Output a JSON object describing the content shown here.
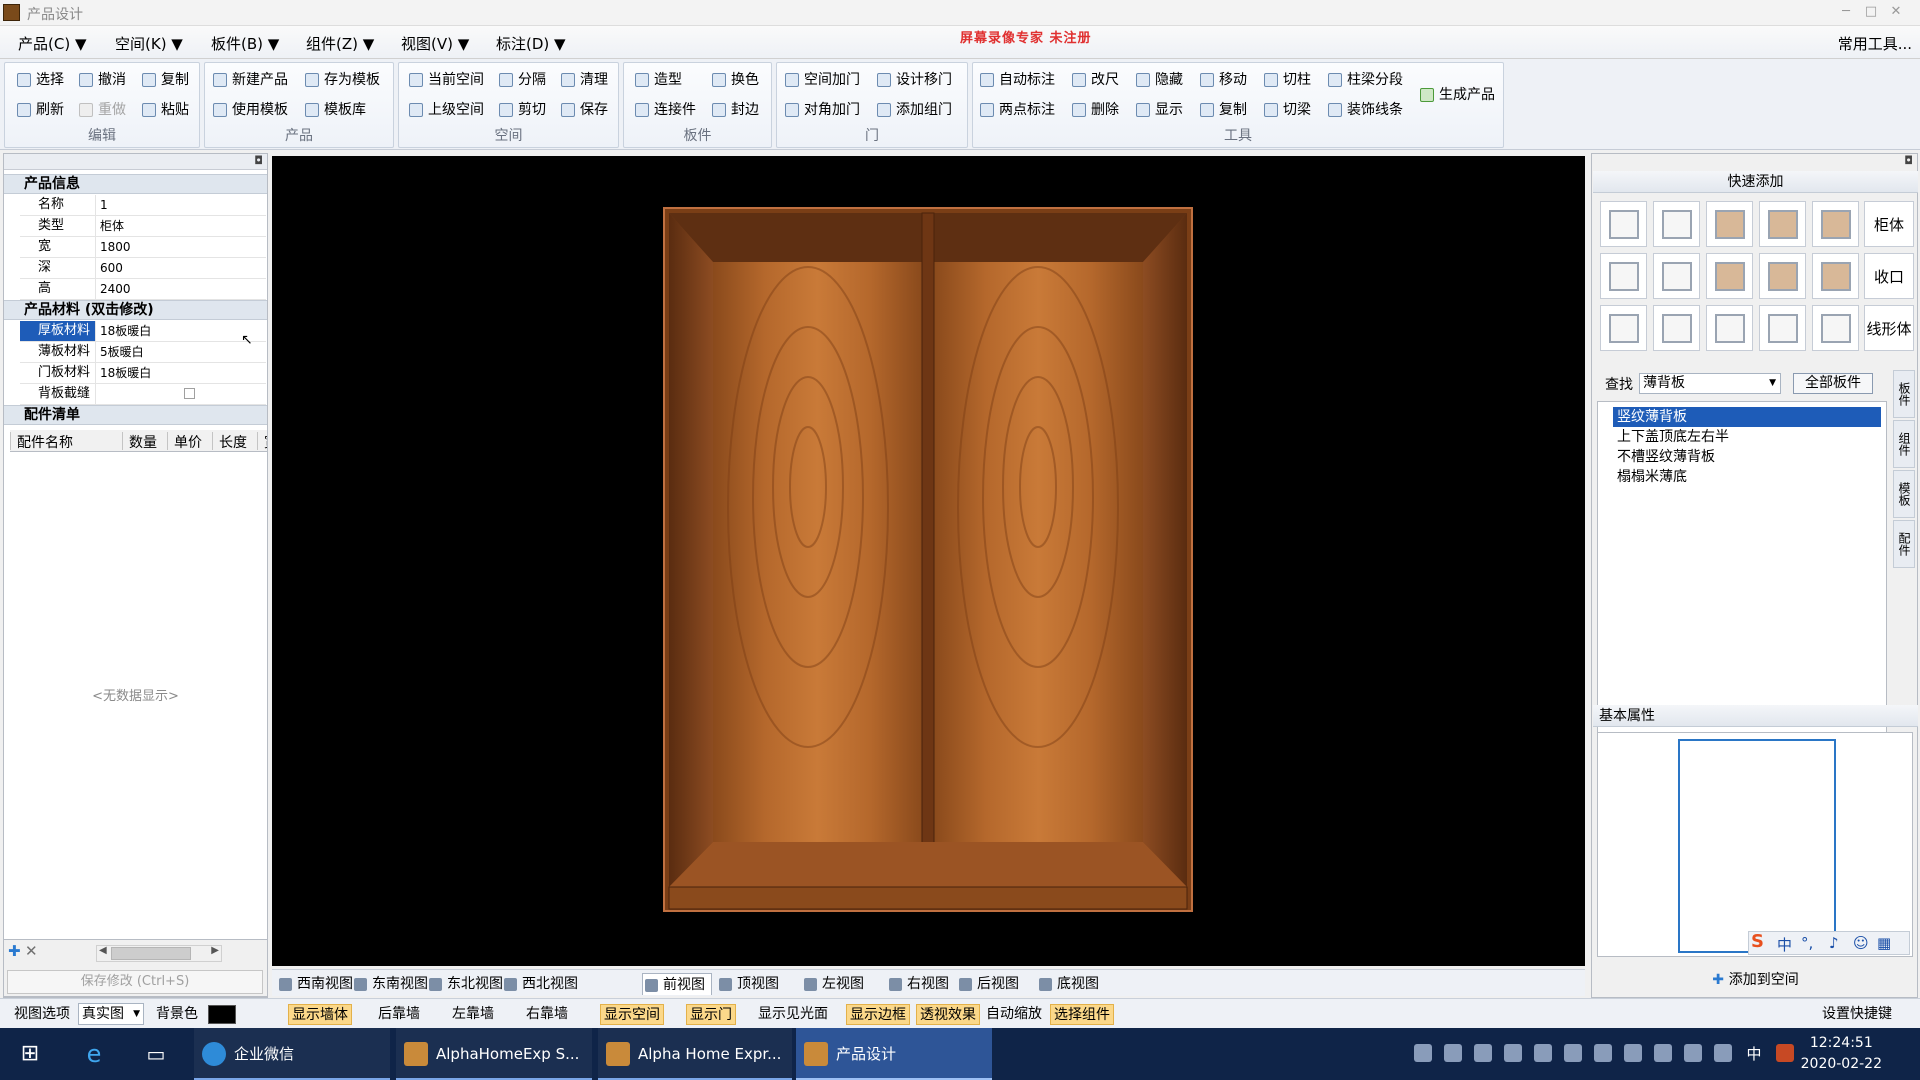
{
  "window": {
    "title": "产品设计",
    "min": "─",
    "max": "□",
    "close": "✕"
  },
  "menu": {
    "items": [
      "产品(C) ▼",
      "空间(K) ▼",
      "板件(B) ▼",
      "组件(Z) ▼",
      "视图(V) ▼",
      "标注(D) ▼"
    ],
    "watermark": "屏幕录像专家  未注册",
    "common_tools": "常用工具..."
  },
  "ribbon": {
    "edit": {
      "name": "编辑",
      "select": "选择",
      "undo": "撤消",
      "copy": "复制",
      "refresh": "刷新",
      "redo": "重做",
      "paste": "粘贴"
    },
    "product": {
      "name": "产品",
      "new_product": "新建产品",
      "save_template": "存为模板",
      "use_template": "使用模板",
      "template_lib": "模板库"
    },
    "space": {
      "name": "空间",
      "current_space": "当前空间",
      "divide": "分隔",
      "clean": "清理",
      "parent_space": "上级空间",
      "cut": "剪切",
      "save": "保存"
    },
    "board": {
      "name": "板件",
      "shape": "造型",
      "swap_color": "换色",
      "connector": "连接件",
      "edge_band": "封边"
    },
    "door": {
      "name": "门",
      "space_add_door": "空间加门",
      "design_move_door": "设计移门",
      "diagonal_door": "对角加门",
      "add_door_group": "添加组门"
    },
    "tools": {
      "name": "工具",
      "auto_dim": "自动标注",
      "change_size": "改尺",
      "hide": "隐藏",
      "move": "移动",
      "cut_column": "切柱",
      "beam_segment": "柱梁分段",
      "two_point_dim": "两点标注",
      "delete": "删除",
      "show": "显示",
      "duplicate": "复制",
      "cut_beam": "切梁",
      "decor_line": "装饰线条"
    },
    "generate": "生成产品"
  },
  "left_panel": {
    "product_info": "产品信息",
    "fields": [
      {
        "k": "名称",
        "v": "1"
      },
      {
        "k": "类型",
        "v": "柜体"
      },
      {
        "k": "宽",
        "v": "1800"
      },
      {
        "k": "深",
        "v": "600"
      },
      {
        "k": "高",
        "v": "2400"
      }
    ],
    "materials_title": "产品材料  (双击修改)",
    "materials": [
      {
        "k": "厚板材料",
        "v": "18板暖白"
      },
      {
        "k": "薄板材料",
        "v": "5板暖白"
      },
      {
        "k": "门板材料",
        "v": "18板暖白"
      },
      {
        "k": "背板截缝",
        "v": ""
      }
    ],
    "parts_title": "配件清单",
    "parts_columns": [
      "配件名称",
      "数量",
      "单价",
      "长度",
      "宽"
    ],
    "no_data": "<无数据显示>",
    "save_button": "保存修改 (Ctrl+S)"
  },
  "view_tabs": [
    "西南视图",
    "东南视图",
    "东北视图",
    "西北视图",
    "前视图",
    "顶视图",
    "左视图",
    "右视图",
    "后视图",
    "底视图"
  ],
  "active_view": "前视图",
  "right_panel": {
    "quick_add": "快速添加",
    "row_labels": [
      "柜体",
      "收口",
      "线形体"
    ],
    "search_label": "查找",
    "search_value": "薄背板",
    "all_boards": "全部板件",
    "side_tabs": [
      "板件",
      "组件",
      "模板",
      "配件"
    ],
    "list": [
      "竖纹薄背板",
      "上下盖顶底左右半",
      "不槽竖纹薄背板",
      "榻榻米薄底"
    ],
    "selected": "竖纹薄背板",
    "basic_props": "基本属性",
    "add_to_space": "添加到空间"
  },
  "status_bar": {
    "view_options": "视图选项",
    "render_mode": "真实图",
    "bg_color_label": "背景色",
    "items": [
      "显示墙体",
      "后靠墙",
      "左靠墙",
      "右靠墙",
      "显示空间",
      "显示门",
      "显示见光面",
      "显示边框",
      "透视效果",
      "自动缩放",
      "选择组件"
    ],
    "shortcut": "设置快捷键"
  },
  "taskbar": {
    "apps": [
      "企业微信",
      "AlphaHomeExp S...",
      "Alpha Home Expr...",
      "产品设计"
    ],
    "time": "12:24:51",
    "date": "2020-02-22",
    "ime": "中"
  }
}
